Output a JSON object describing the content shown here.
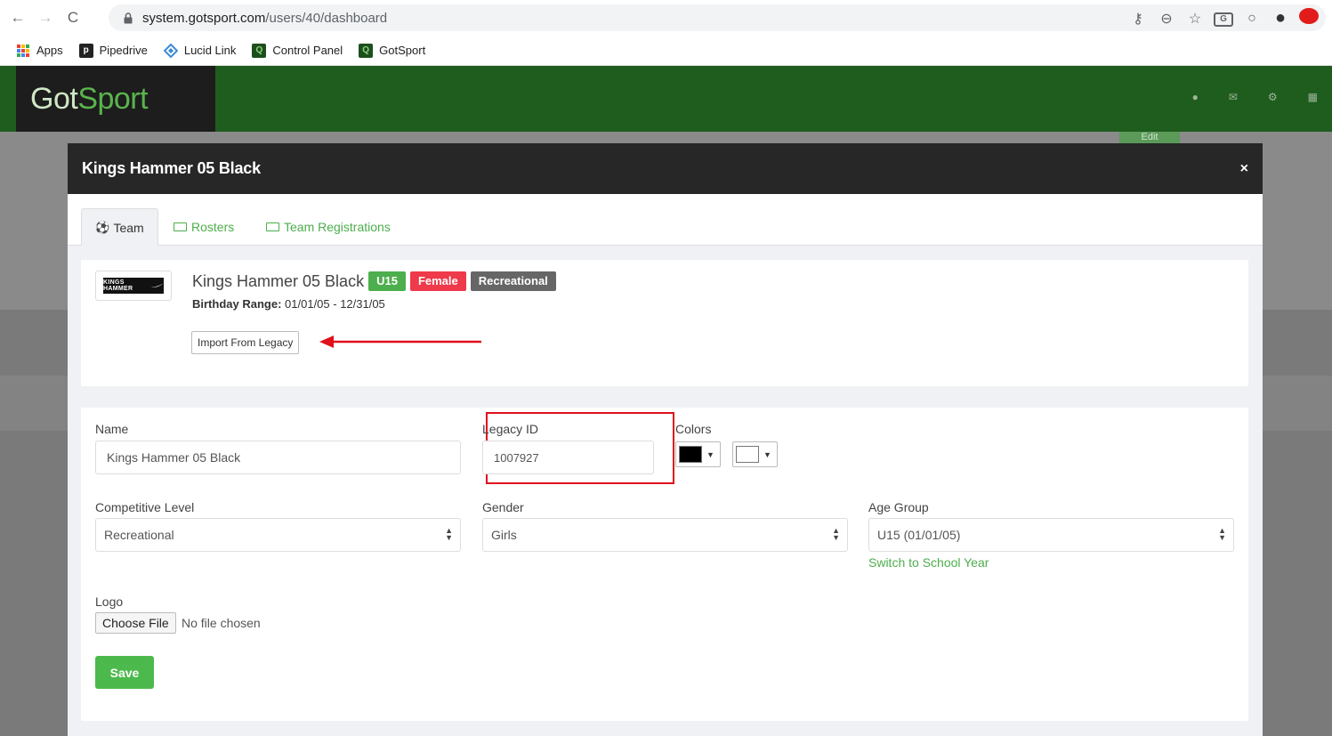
{
  "browser": {
    "url_host": "system.gotsport.com",
    "url_path": "/users/40/dashboard",
    "bookmarks": [
      {
        "label": "Apps",
        "icon": "apps-grid-icon"
      },
      {
        "label": "Pipedrive",
        "icon": "pipedrive-icon"
      },
      {
        "label": "Lucid Link",
        "icon": "lucidlink-icon"
      },
      {
        "label": "Control Panel",
        "icon": "gotsport-favicon"
      },
      {
        "label": "GotSport",
        "icon": "gotsport-favicon"
      }
    ]
  },
  "app": {
    "logo_part1": "Got",
    "logo_part2": "Sport",
    "background_button": "Edit"
  },
  "modal": {
    "title": "Kings Hammer 05 Black",
    "close_glyph": "×",
    "tabs": [
      {
        "label": "Team",
        "icon": "soccer-ball-icon",
        "active": true
      },
      {
        "label": "Rosters",
        "icon": "id-card-icon",
        "active": false
      },
      {
        "label": "Team Registrations",
        "icon": "list-icon",
        "active": false
      }
    ],
    "summary": {
      "team_name": "Kings Hammer 05 Black",
      "badges": [
        "U15",
        "Female",
        "Recreational"
      ],
      "birthday_label": "Birthday Range:",
      "birthday_value": "01/01/05 - 12/31/05",
      "import_button": "Import From Legacy",
      "logo_text": "KINGS HAMMER"
    },
    "form": {
      "name_label": "Name",
      "name_value": "Kings Hammer 05 Black",
      "legacy_label": "Legacy ID",
      "legacy_value": "1007927",
      "colors_label": "Colors",
      "color_primary": "#000000",
      "color_secondary": "#ffffff",
      "competitive_label": "Competitive Level",
      "competitive_value": "Recreational",
      "gender_label": "Gender",
      "gender_value": "Girls",
      "age_label": "Age Group",
      "age_value": "U15 (01/01/05)",
      "switch_link": "Switch to School Year",
      "logo_label": "Logo",
      "file_button": "Choose File",
      "file_status": "No file chosen",
      "save_button": "Save"
    }
  },
  "colors": {
    "header_green": "#1e5d1d",
    "accent_green": "#4cae4c",
    "badge_red": "#ee3a4a",
    "annotation_red": "#e0101d"
  }
}
